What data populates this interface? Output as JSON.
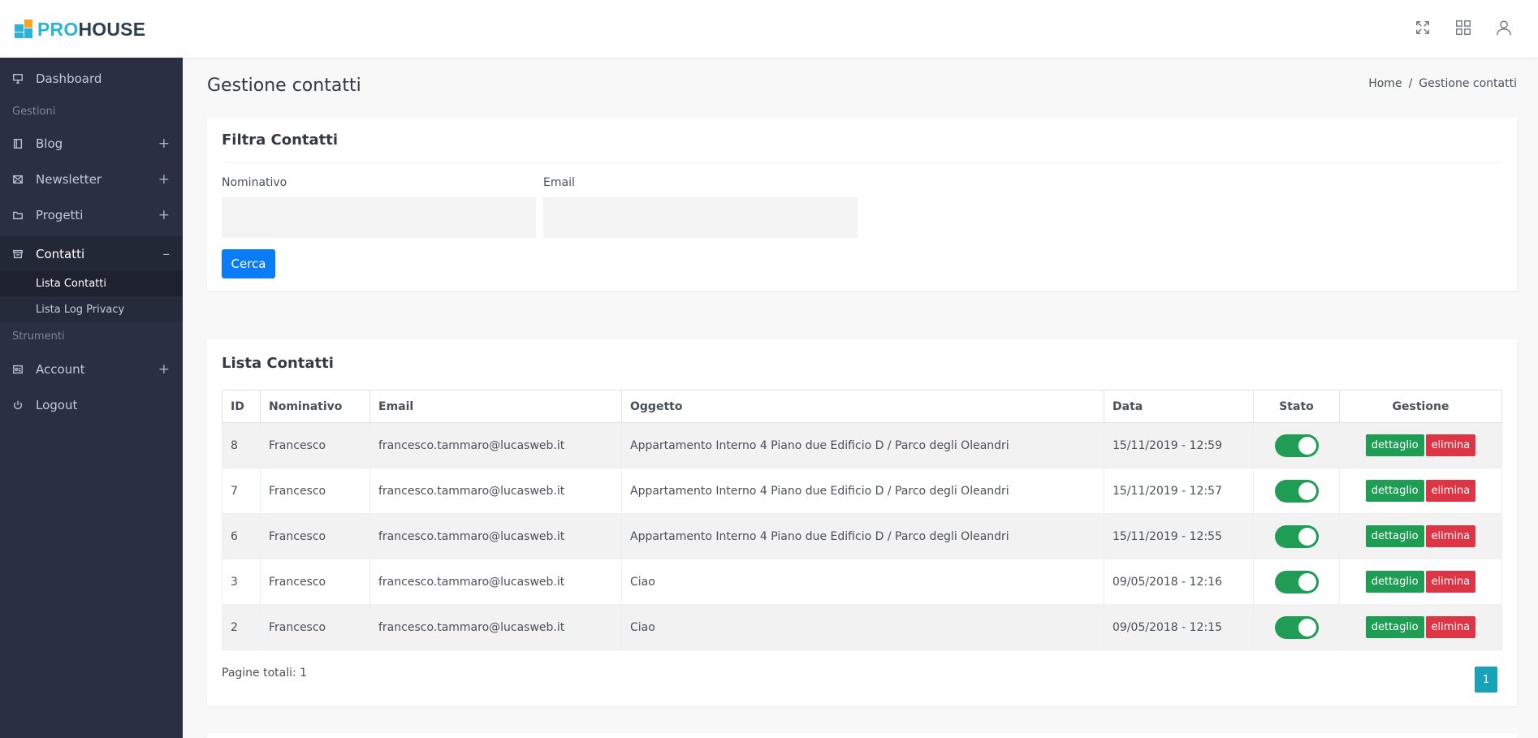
{
  "brand": {
    "part1": "PRO",
    "part2": "HOUSE"
  },
  "topbar": {
    "icons": [
      "fullscreen-icon",
      "apps-grid-icon",
      "user-icon"
    ]
  },
  "sidebar": {
    "items": [
      {
        "label": "Dashboard",
        "icon": "monitor-icon"
      },
      {
        "header": "Gestioni"
      },
      {
        "label": "Blog",
        "icon": "book-icon",
        "toggle": "+"
      },
      {
        "label": "Newsletter",
        "icon": "mail-icon",
        "toggle": "+"
      },
      {
        "label": "Progetti",
        "icon": "folder-icon",
        "toggle": "+"
      },
      {
        "label": "Contatti",
        "icon": "archive-icon",
        "toggle": "–"
      },
      {
        "header": "Strumenti"
      },
      {
        "label": "Account",
        "icon": "id-card-icon",
        "toggle": "+"
      },
      {
        "label": "Logout",
        "icon": "power-icon"
      }
    ],
    "subitems": [
      "Lista Contatti",
      "Lista Log Privacy"
    ]
  },
  "page": {
    "title": "Gestione contatti",
    "breadcrumb": {
      "home": "Home",
      "sep": "/",
      "current": "Gestione contatti"
    }
  },
  "filter": {
    "title": "Filtra Contatti",
    "nominativo_label": "Nominativo",
    "nominativo_value": "",
    "email_label": "Email",
    "email_value": "",
    "search_label": "Cerca"
  },
  "list": {
    "title": "Lista Contatti",
    "columns": [
      "ID",
      "Nominativo",
      "Email",
      "Oggetto",
      "Data",
      "Stato",
      "Gestione"
    ],
    "rows": [
      {
        "id": "8",
        "nominativo": "Francesco",
        "email": "francesco.tammaro@lucasweb.it",
        "oggetto": "Appartamento Interno 4 Piano due Edificio D / Parco degli Oleandri",
        "data": "15/11/2019 - 12:59",
        "stato": true
      },
      {
        "id": "7",
        "nominativo": "Francesco",
        "email": "francesco.tammaro@lucasweb.it",
        "oggetto": "Appartamento Interno 4 Piano due Edificio D / Parco degli Oleandri",
        "data": "15/11/2019 - 12:57",
        "stato": true
      },
      {
        "id": "6",
        "nominativo": "Francesco",
        "email": "francesco.tammaro@lucasweb.it",
        "oggetto": "Appartamento Interno 4 Piano due Edificio D / Parco degli Oleandri",
        "data": "15/11/2019 - 12:55",
        "stato": true
      },
      {
        "id": "3",
        "nominativo": "Francesco",
        "email": "francesco.tammaro@lucasweb.it",
        "oggetto": "Ciao",
        "data": "09/05/2018 - 12:16",
        "stato": true
      },
      {
        "id": "2",
        "nominativo": "Francesco",
        "email": "francesco.tammaro@lucasweb.it",
        "oggetto": "Ciao",
        "data": "09/05/2018 - 12:15",
        "stato": true
      }
    ],
    "detail_label": "dettaglio",
    "delete_label": "elimina",
    "pages_total": "Pagine totali: 1",
    "current_page": "1"
  },
  "colors": {
    "sidebar_bg": "#2a3042",
    "primary": "#0a7cf5",
    "success": "#1f9d55",
    "danger": "#dc3545",
    "info": "#17a2b8"
  }
}
